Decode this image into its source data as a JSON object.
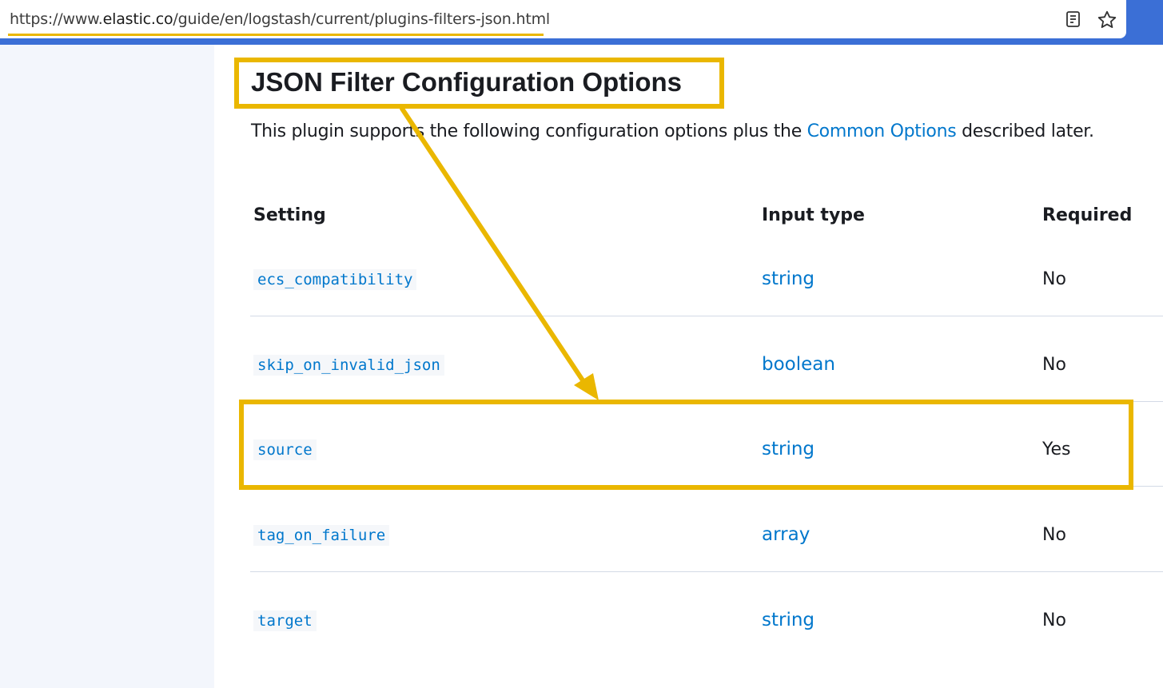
{
  "browser": {
    "url_prefix": "https://www.",
    "url_host": "elastic.co",
    "url_path": "/guide/en/logstash/current/plugins-filters-json.html",
    "reader_icon": "reader-mode-icon",
    "bookmark_icon": "star-icon"
  },
  "page": {
    "title": "JSON Filter Configuration Options",
    "intro_before": "This plugin supports the following configuration options plus the ",
    "intro_link": "Common Options",
    "intro_after": " described later."
  },
  "table": {
    "headers": [
      "Setting",
      "Input type",
      "Required"
    ],
    "rows": [
      {
        "setting": "ecs_compatibility",
        "type": "string",
        "required": "No"
      },
      {
        "setting": "skip_on_invalid_json",
        "type": "boolean",
        "required": "No"
      },
      {
        "setting": "source",
        "type": "string",
        "required": "Yes"
      },
      {
        "setting": "tag_on_failure",
        "type": "array",
        "required": "No"
      },
      {
        "setting": "target",
        "type": "string",
        "required": "No"
      }
    ]
  },
  "annotation": {
    "color": "#eab700",
    "link_color": "#0077cc"
  }
}
